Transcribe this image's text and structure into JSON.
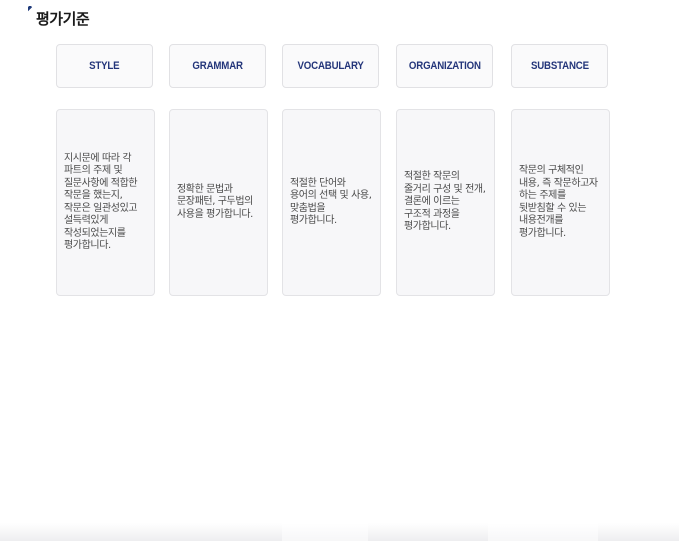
{
  "heading": {
    "title": "평가기준"
  },
  "criteria": [
    {
      "label": "STYLE",
      "description": "지시문에 따라 각 파트의 주제 및 질문사항에 적합한 작문을 했는지, 작문은 일관성있고 설득력있게 작성되었는지를 평가합니다."
    },
    {
      "label": "GRAMMAR",
      "description": "정확한 문법과 문장패턴, 구두법의 사용을 평가합니다."
    },
    {
      "label": "VOCABULARY",
      "description": "적절한 단어와 용어의 선택 및 사용, 맞춤법을 평가합니다."
    },
    {
      "label": "ORGANIZATION",
      "description": "적절한 작문의 줄거리 구성 및 전개, 결론에 이르는 구조적 과정을 평가합니다."
    },
    {
      "label": "SUBSTANCE",
      "description": "작문의 구체적인 내용, 즉 작문하고자 하는 주제를 뒷받침할 수 있는 내용전개를 평가합니다."
    }
  ]
}
